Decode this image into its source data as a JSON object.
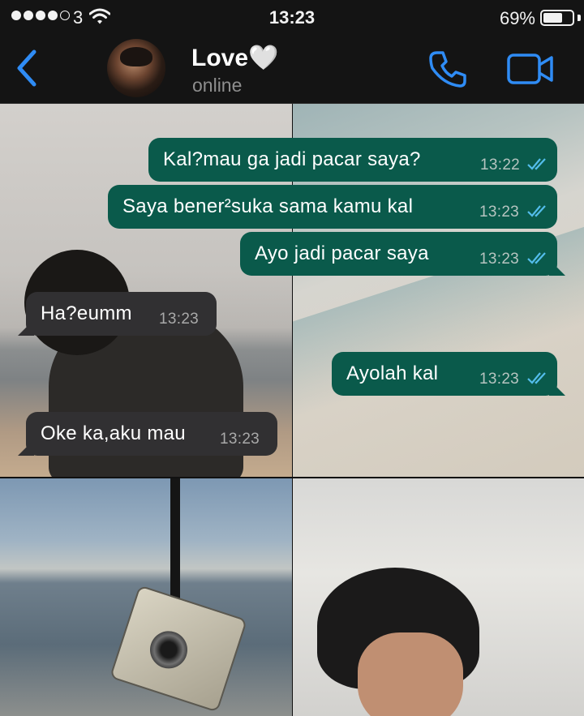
{
  "status_bar": {
    "carrier": "3",
    "time": "13:23",
    "battery": "69%",
    "battery_level": 0.69,
    "signal_bars": 4,
    "signal_max": 5
  },
  "header": {
    "contact_name": "Love🤍",
    "contact_status": "online",
    "icons": {
      "back": "chevron-left-icon",
      "call": "phone-icon",
      "video": "video-camera-icon"
    },
    "accent_color": "#2f8cf5"
  },
  "messages": [
    {
      "direction": "outgoing",
      "text": "Kal?mau ga jadi pacar saya?",
      "time": "13:22",
      "read": true
    },
    {
      "direction": "outgoing",
      "text": "Saya bener²suka sama kamu kal",
      "time": "13:23",
      "read": true
    },
    {
      "direction": "outgoing",
      "text": "Ayo jadi pacar saya",
      "time": "13:23",
      "read": true
    },
    {
      "direction": "incoming",
      "text": "Ha?eumm",
      "time": "13:23"
    },
    {
      "direction": "outgoing",
      "text": "Ayolah kal",
      "time": "13:23",
      "read": true
    },
    {
      "direction": "incoming",
      "text": "Oke ka,aku mau",
      "time": "13:23"
    }
  ],
  "colors": {
    "outgoing_bubble": "#0a5a4b",
    "incoming_bubble": "#313032",
    "read_ticks": "#53bdeb"
  }
}
